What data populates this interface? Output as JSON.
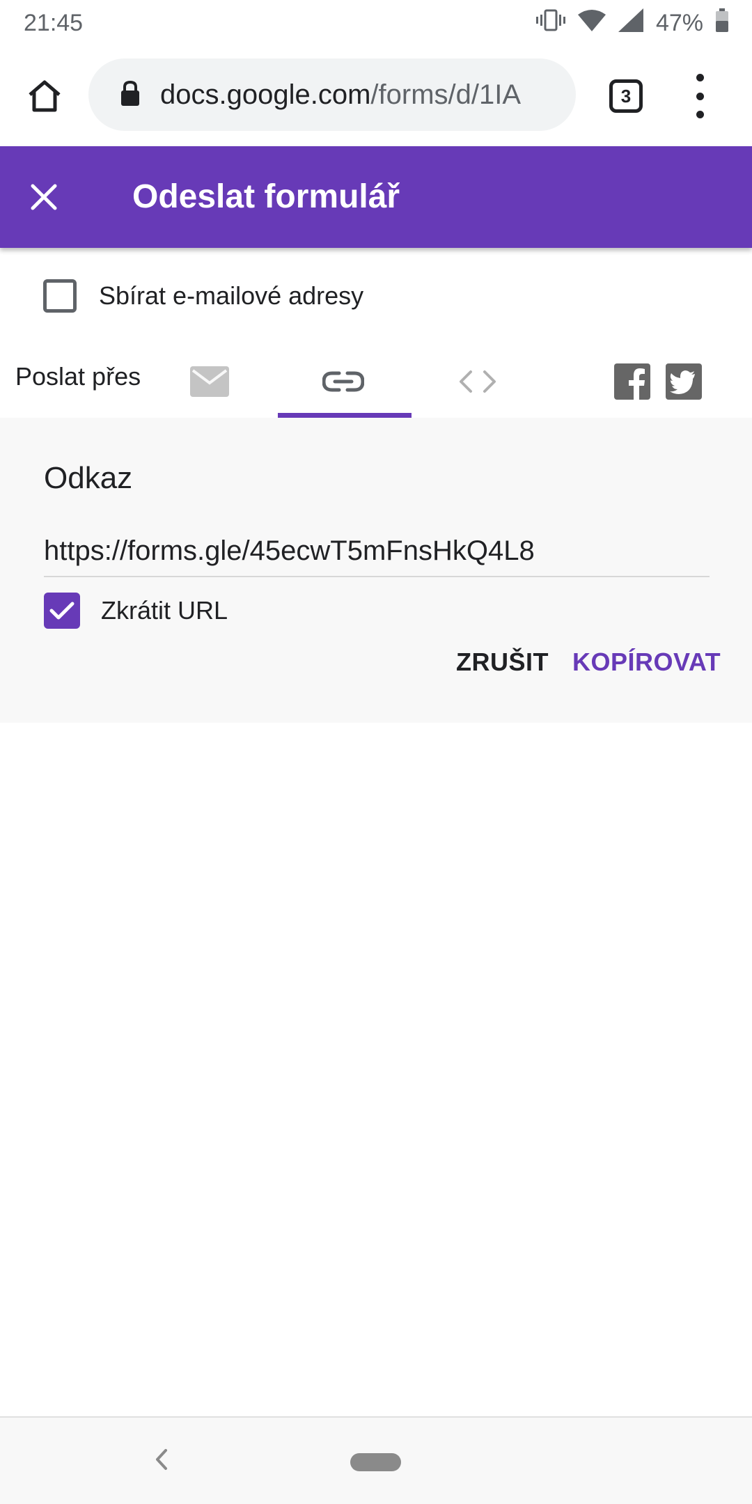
{
  "status_bar": {
    "time": "21:45",
    "battery": "47%",
    "icons": [
      "vibrate-icon",
      "wifi-icon",
      "signal-icon",
      "battery-icon"
    ]
  },
  "browser": {
    "url_domain": "docs.google.com",
    "url_path": "/forms/d/1IA",
    "tab_count": "3",
    "icons": [
      "home-icon",
      "lock-icon",
      "more-vert-icon"
    ]
  },
  "dialog": {
    "title": "Odeslat formulář",
    "close_icon": "close-icon"
  },
  "collect_emails": {
    "label": "Sbírat e-mailové adresy",
    "checked": false
  },
  "send_via": {
    "label": "Poslat přes",
    "tabs": [
      "mail-icon",
      "link-icon",
      "embed-code-icon"
    ],
    "selected_tab": "link-icon",
    "share": [
      "facebook-icon",
      "twitter-icon"
    ]
  },
  "link_panel": {
    "heading": "Odkaz",
    "url_value": "https://forms.gle/45ecwT5mFnsHkQ4L8",
    "shorten_label": "Zkrátit URL",
    "shorten_checked": true,
    "cancel_label": "ZRUŠIT",
    "copy_label": "KOPÍROVAT"
  },
  "colors": {
    "accent": "#673ab7",
    "panel_background": "#f8f8f8",
    "icon_gray": "#8a8a8a"
  }
}
